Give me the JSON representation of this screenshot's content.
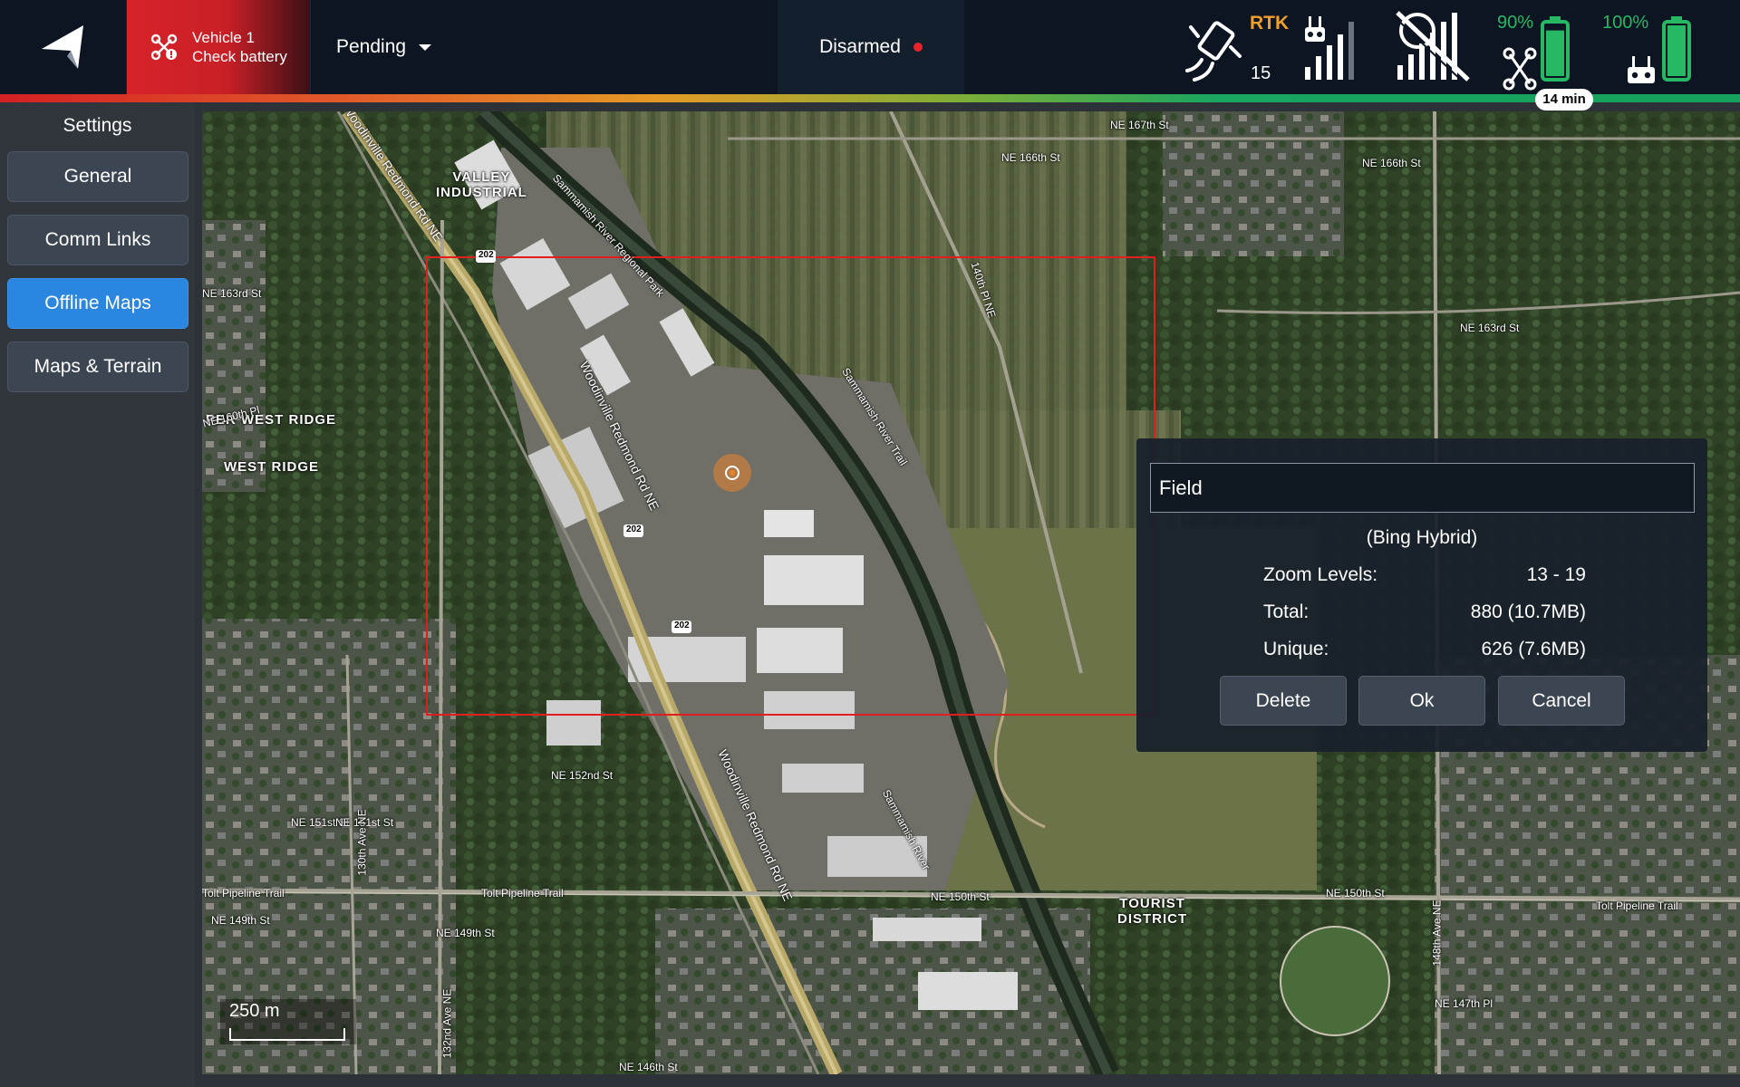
{
  "topbar": {
    "vehicle": {
      "name": "Vehicle 1",
      "message": "Check battery"
    },
    "flight_mode": "Pending",
    "arm_state": "Disarmed",
    "gps": {
      "label": "RTK",
      "satellite_count": "15"
    },
    "vehicle_battery": {
      "percent": "90%",
      "fill_fraction": 0.9
    },
    "controller_battery": {
      "percent": "100%",
      "fill_fraction": 1.0
    },
    "flight_time": "14 min",
    "colors": {
      "accent": "#2a86df",
      "warning": "#d8232a",
      "gps": "#f0a02a",
      "battery": "#27b864"
    }
  },
  "sidebar": {
    "title": "Settings",
    "items": [
      {
        "label": "General",
        "active": false
      },
      {
        "label": "Comm Links",
        "active": false
      },
      {
        "label": "Offline Maps",
        "active": true
      },
      {
        "label": "Maps & Terrain",
        "active": false
      }
    ]
  },
  "map": {
    "scale_label": "250 m",
    "labels": {
      "valley_industrial": "VALLEY\nINDUSTRIAL",
      "upper_west_ridge": "PER WEST RIDGE",
      "west_ridge": "WEST RIDGE",
      "tourist_district": "TOURIST\nDISTRICT",
      "woodinville_rd_1": "Woodinville Redmond Rd NE",
      "woodinville_rd_2": "Woodinville Redmond Rd NE",
      "woodinville_rd_3": "Woodinville Redmond Rd NE",
      "sammamish_park": "Sammamish River Regional Park",
      "sammamish_trail": "Sammamish River Trail",
      "sammamish_river": "Sammamish River",
      "ne167": "NE 167th St",
      "ne166": "NE 166th St",
      "ne166b": "NE 166th St",
      "ne163": "NE 163rd St",
      "ne163b": "NE 163rd St",
      "ne152": "NE 152nd St",
      "ne151": "NE 151st St",
      "ne151b": "NE 151st St",
      "ne150": "NE 150th St",
      "ne150b": "NE 150th St",
      "ne149": "NE 149th St",
      "ne149b": "NE 149th St",
      "ne147": "NE 147th Pl",
      "ne146": "NE 146th St",
      "tolt1": "Tolt Pipeline Trail",
      "tolt2": "Tolt Pipeline Trail",
      "tolt3": "Tolt Pipeline Trail",
      "ne160": "NE 160th Pl",
      "ave140": "140th Pl NE",
      "ave148": "148th Ave NE",
      "ave130": "130th Ave NE",
      "ave132": "132nd Ave NE",
      "sr202a": "202",
      "sr202b": "202",
      "sr202c": "202"
    }
  },
  "dialog": {
    "name_value": "Field",
    "map_type": "(Bing Hybrid)",
    "rows": [
      {
        "key": "Zoom Levels:",
        "value": "13 - 19"
      },
      {
        "key": "Total:",
        "value": "880 (10.7MB)"
      },
      {
        "key": "Unique:",
        "value": "626 (7.6MB)"
      }
    ],
    "buttons": {
      "delete": "Delete",
      "ok": "Ok",
      "cancel": "Cancel"
    }
  }
}
